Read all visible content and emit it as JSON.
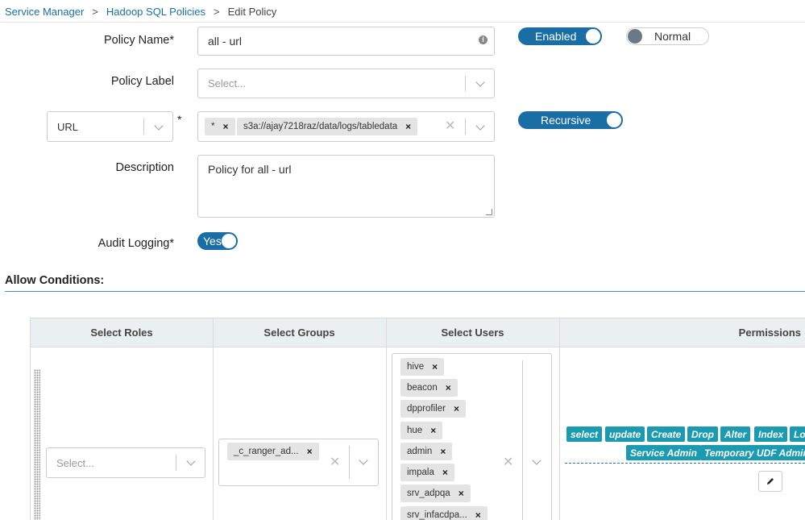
{
  "breadcrumb": {
    "items": [
      "Service Manager",
      "Hadoop SQL Policies"
    ],
    "current": "Edit Policy",
    "separator": ">"
  },
  "form": {
    "policy_name_label": "Policy Name*",
    "policy_name_value": "all - url",
    "policy_label_label": "Policy Label",
    "policy_label_placeholder": "Select...",
    "resource_type": "URL",
    "resource_required": "*",
    "resource_values": [
      "*",
      "s3a://ajay7218raz/data/logs/tabledata"
    ],
    "description_label": "Description",
    "description_value": "Policy for all - url",
    "audit_logging_label": "Audit Logging*"
  },
  "toggles": {
    "enabled": {
      "label": "Enabled",
      "on": true
    },
    "normal": {
      "label": "Normal",
      "on": false
    },
    "recursive": {
      "label": "Recursive",
      "on": true
    },
    "audit": {
      "label": "Yes",
      "on": true
    }
  },
  "allow_conditions": {
    "title": "Allow Conditions:",
    "columns": [
      "Select Roles",
      "Select Groups",
      "Select Users",
      "Permissions"
    ],
    "roles_placeholder": "Select...",
    "groups": [
      "_c_ranger_ad..."
    ],
    "users": [
      "hive",
      "beacon",
      "dpprofiler",
      "hue",
      "admin",
      "impala",
      "srv_adpqa",
      "srv_infacdpa..."
    ],
    "permissions": [
      "select",
      "update",
      "Create",
      "Drop",
      "Alter",
      "Index",
      "Lo",
      "Service Admin",
      "Temporary UDF Admin"
    ]
  },
  "colors": {
    "accent": "#1a6ea6",
    "permission_chip": "#1a9bb2",
    "link": "#1b6fa8"
  },
  "icons": {
    "info": "info-icon",
    "edit": "pencil-icon"
  }
}
